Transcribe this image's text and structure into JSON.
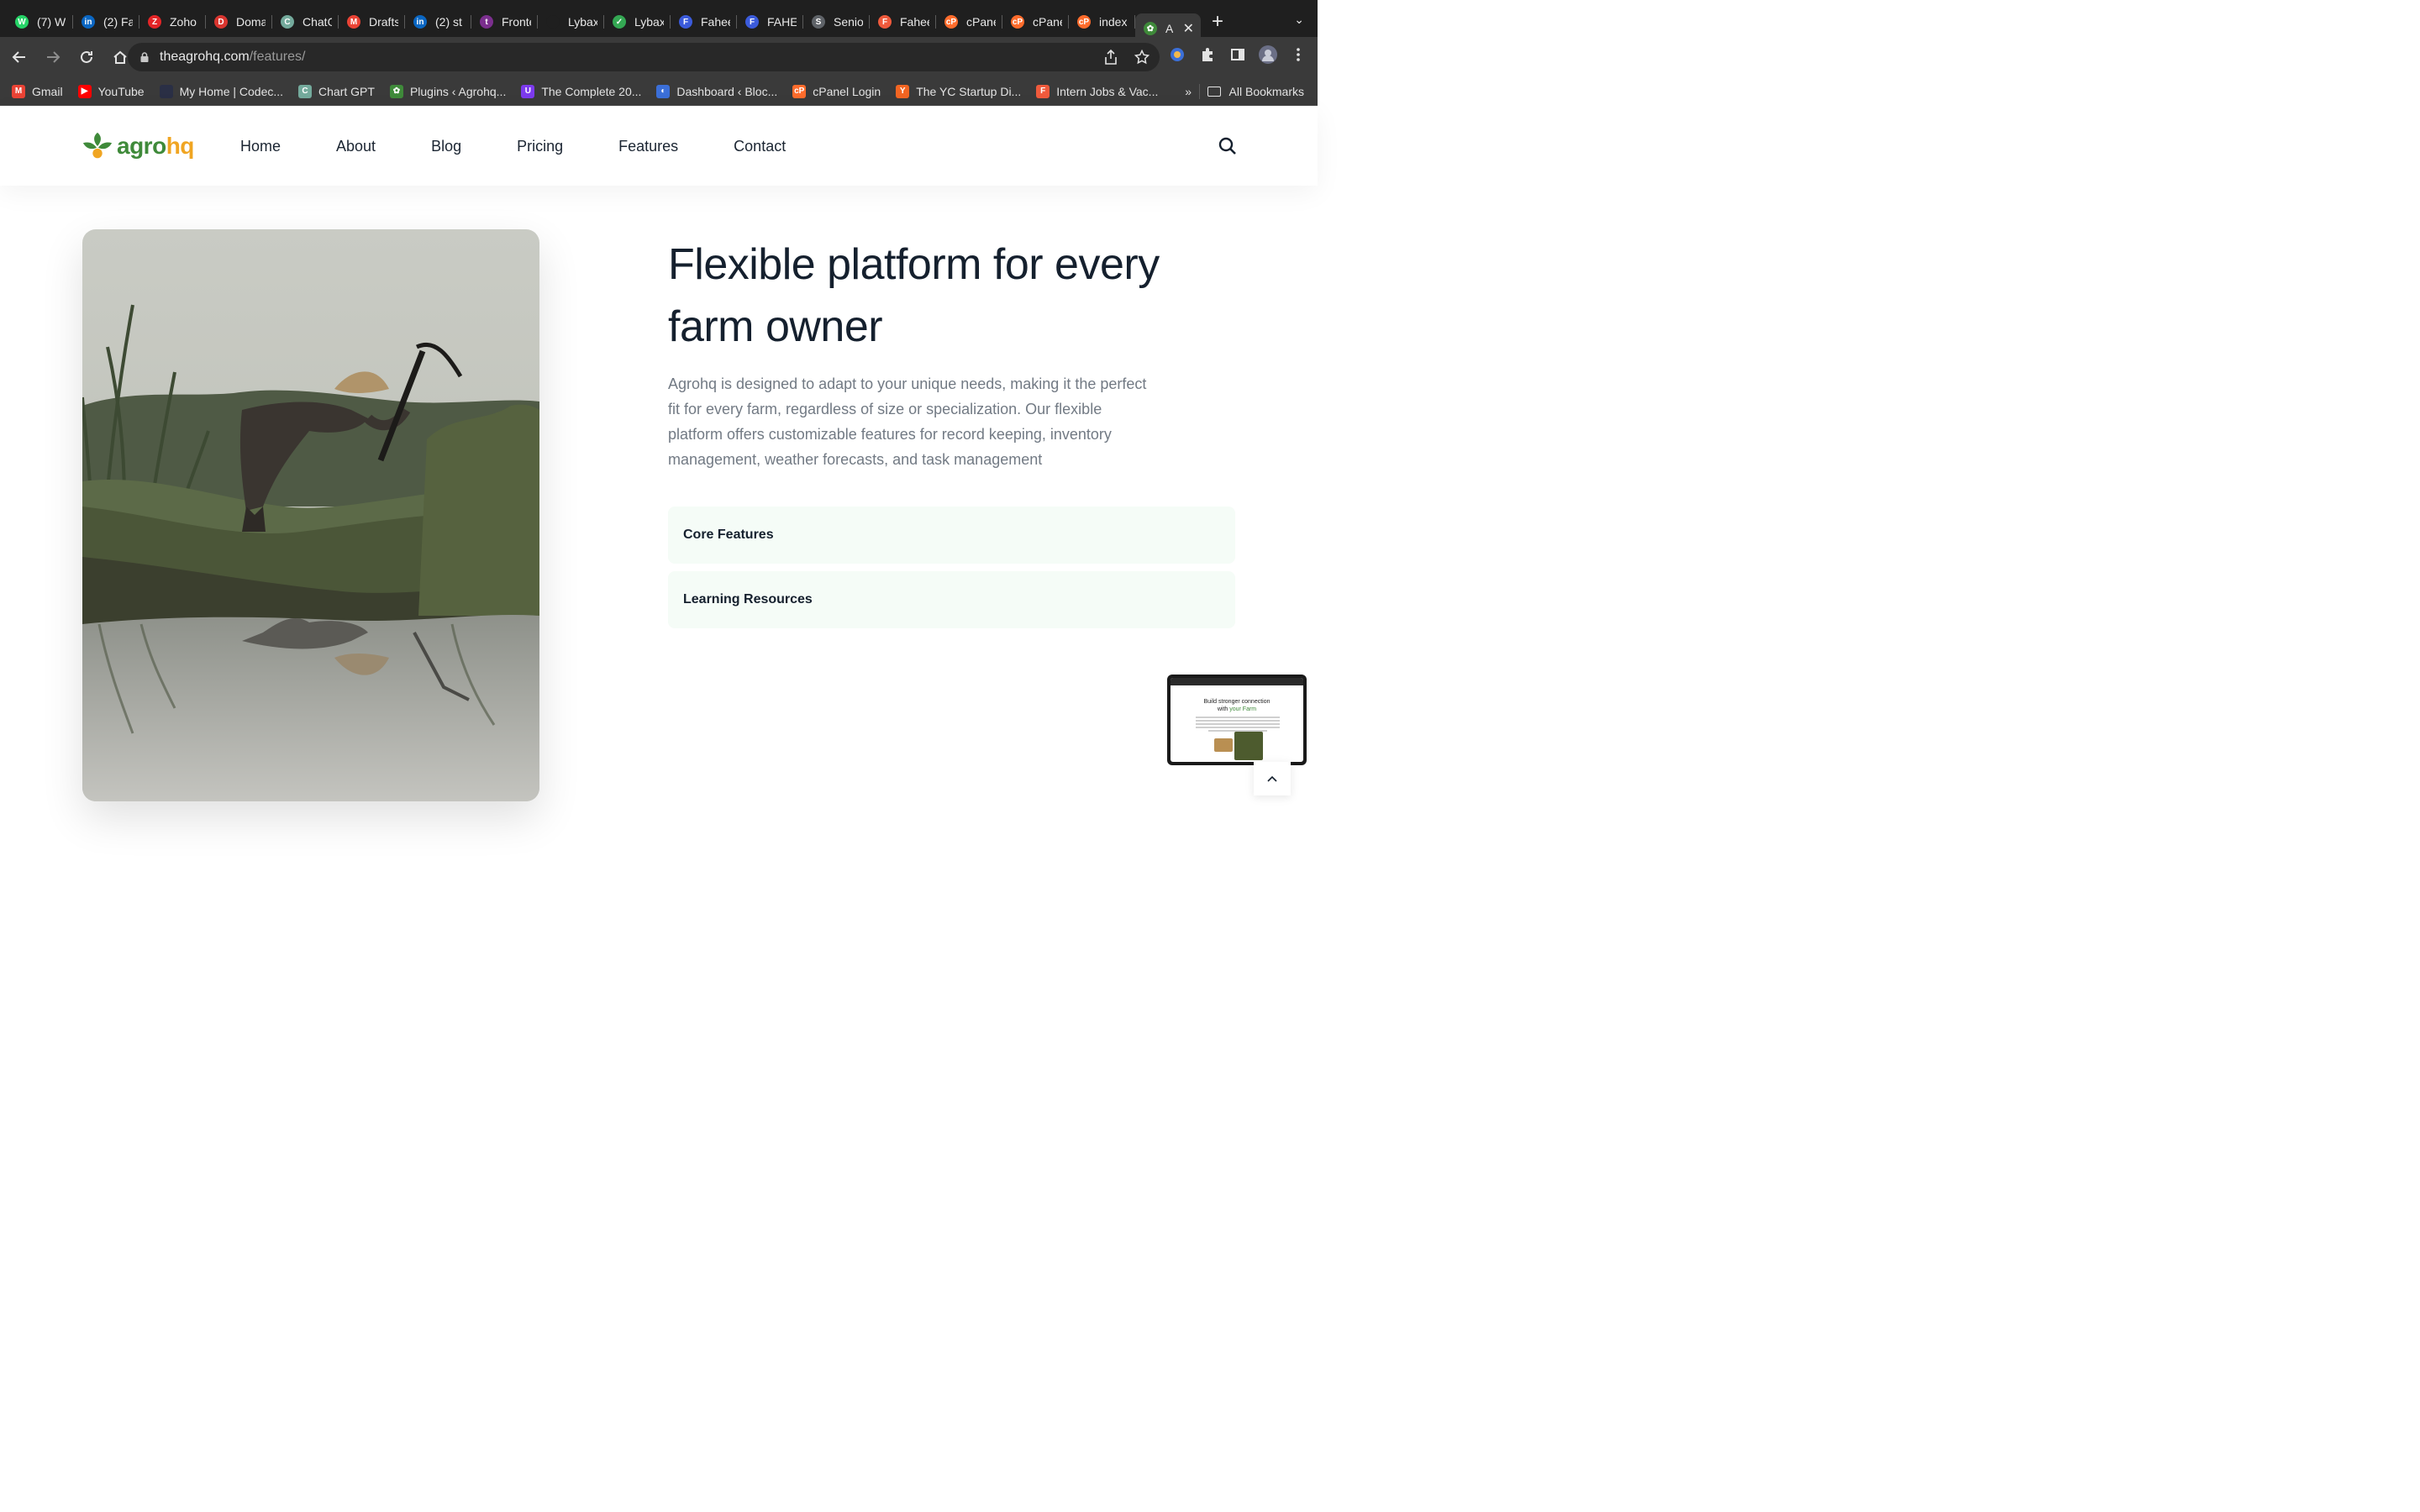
{
  "browser": {
    "tabs": [
      {
        "title": "(7) W",
        "color": "#25d366",
        "glyph": "W"
      },
      {
        "title": "(2) Fa",
        "color": "#0a66c2",
        "glyph": "in"
      },
      {
        "title": "Zoho",
        "color": "#e42527",
        "glyph": "Z"
      },
      {
        "title": "Doma",
        "color": "#d9352f",
        "glyph": "D"
      },
      {
        "title": "ChatG",
        "color": "#74aa9c",
        "glyph": "C"
      },
      {
        "title": "Drafts",
        "color": "#ea4335",
        "glyph": "M"
      },
      {
        "title": "(2) st",
        "color": "#0a66c2",
        "glyph": "in"
      },
      {
        "title": "Fronte",
        "color": "#7b2f8e",
        "glyph": "t"
      },
      {
        "title": "Lybax",
        "color": "#1f1f1f",
        "glyph": ""
      },
      {
        "title": "Lybax",
        "color": "#34a853",
        "glyph": "✓"
      },
      {
        "title": "Fahee",
        "color": "#3b5bdb",
        "glyph": "F"
      },
      {
        "title": "FAHEI",
        "color": "#3b5bdb",
        "glyph": "F"
      },
      {
        "title": "Senio",
        "color": "#5f6368",
        "glyph": "S"
      },
      {
        "title": "Fahee",
        "color": "#ef5a3c",
        "glyph": "F"
      },
      {
        "title": "cPane",
        "color": "#ff6c2c",
        "glyph": "cP"
      },
      {
        "title": "cPane",
        "color": "#ff6c2c",
        "glyph": "cP"
      },
      {
        "title": "index",
        "color": "#ff6c2c",
        "glyph": "cP"
      }
    ],
    "active_tab": {
      "title": "A",
      "close": "✕"
    },
    "new_tab": "+",
    "tab_menu": "⌄",
    "url_host": "theagrohq.com",
    "url_path": "/features/",
    "bookmarks": [
      {
        "label": "Gmail",
        "color": "#ea4335",
        "glyph": "M"
      },
      {
        "label": "YouTube",
        "color": "#ff0000",
        "glyph": "▶"
      },
      {
        "label": "My Home | Codec...",
        "color": "#2a2f45",
        "glyph": ""
      },
      {
        "label": "Chart GPT",
        "color": "#74aa9c",
        "glyph": "C"
      },
      {
        "label": "Plugins ‹ Agrohq...",
        "color": "#3f8a3a",
        "glyph": "✿"
      },
      {
        "label": "The Complete 20...",
        "color": "#7c3aed",
        "glyph": "U"
      },
      {
        "label": "Dashboard ‹ Bloc...",
        "color": "#3b6fd8",
        "glyph": "◐"
      },
      {
        "label": "cPanel Login",
        "color": "#ff6c2c",
        "glyph": "cP"
      },
      {
        "label": "The YC Startup Di...",
        "color": "#f26522",
        "glyph": "Y"
      },
      {
        "label": "Intern Jobs & Vac...",
        "color": "#ef5a3c",
        "glyph": "F"
      }
    ],
    "bookmarks_more": "»",
    "all_bookmarks": "All Bookmarks"
  },
  "site": {
    "logo": {
      "part1": "agro",
      "part2": "hq"
    },
    "nav": [
      "Home",
      "About",
      "Blog",
      "Pricing",
      "Features",
      "Contact"
    ],
    "hero": {
      "headline": "Flexible platform for every farm owner",
      "body": "Agrohq is designed to adapt to your unique needs, making it the perfect fit for every farm, regardless of size or specialization. Our flexible platform offers customizable features for record keeping, inventory management, weather forecasts, and task management"
    },
    "accordion": [
      "Core Features",
      "Learning Resources"
    ],
    "preview": {
      "line1": "Build stronger connection",
      "line2a": "with ",
      "line2b": "your Farm"
    }
  },
  "colors": {
    "brand_green": "#3f8a3a",
    "brand_orange": "#f0a522",
    "heading": "#15202e",
    "accordion_bg": "#f5fcf7"
  }
}
